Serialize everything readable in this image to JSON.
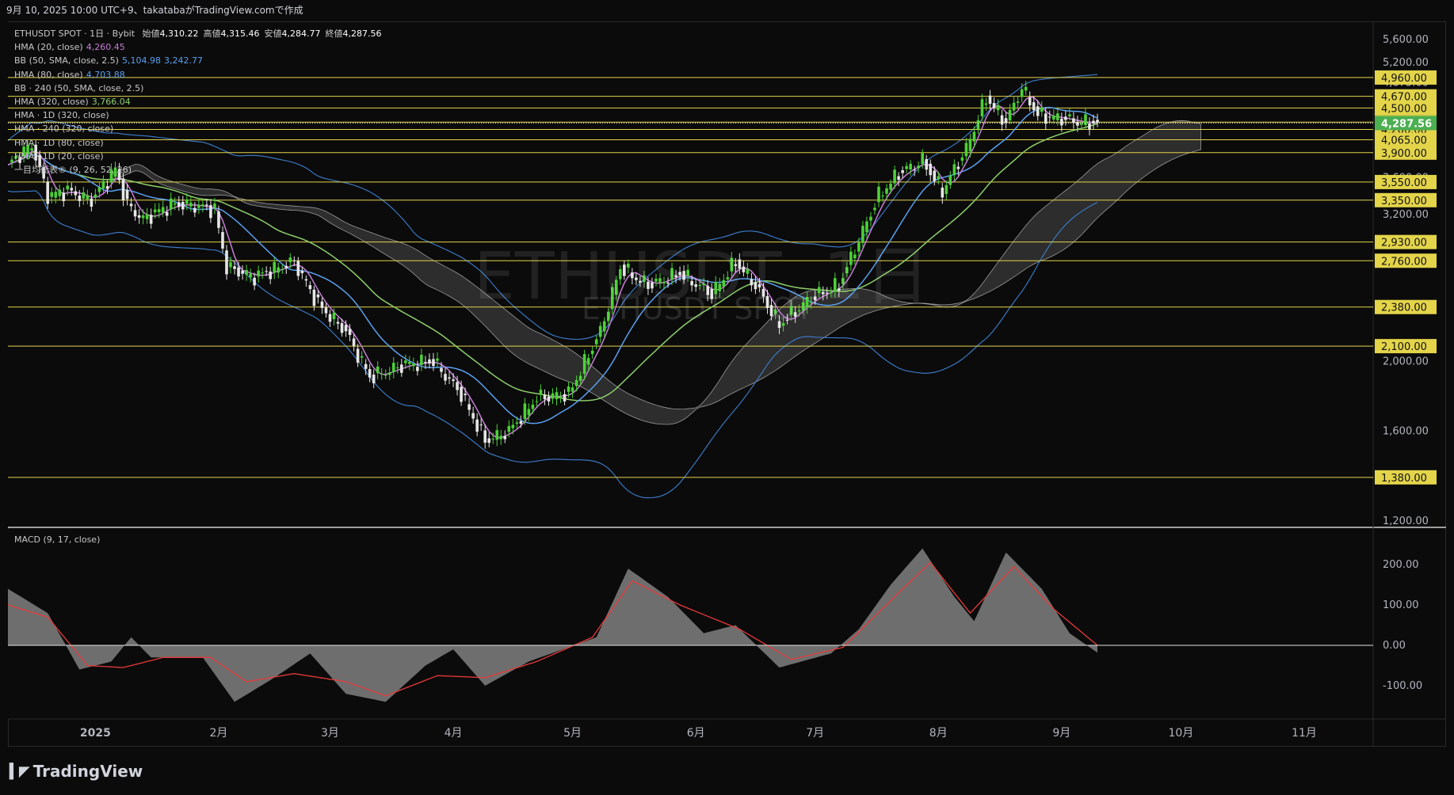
{
  "header": "9月 10, 2025 10:00 UTC+9、takatabaがTradingView.comで作成",
  "watermark": {
    "symbol": "ETHUSDT, 1日",
    "sub": "ETHUSDT SPOT"
  },
  "legend": {
    "title": "ETHUSDT SPOT · 1日 · Bybit",
    "ohlc": [
      {
        "label": "始値",
        "value": "4,310.22"
      },
      {
        "label": "高値",
        "value": "4,315.46"
      },
      {
        "label": "安値",
        "value": "4,284.77"
      },
      {
        "label": "終値",
        "value": "4,287.56"
      }
    ],
    "indicators": [
      {
        "label": "HMA (20, close)",
        "values": [
          "4,260.45"
        ],
        "color": "#c77dd6"
      },
      {
        "label": "BB (50, SMA, close, 2.5)",
        "values": [
          "5,104.98",
          "3,242.77"
        ],
        "color": "#5aa0f0"
      },
      {
        "label": "HMA (80, close)",
        "values": [
          "4,703.88"
        ],
        "color": "#5aa0f0"
      },
      {
        "label": "BB · 240 (50, SMA, close, 2.5)",
        "values": [],
        "color": "#c8c8c8"
      },
      {
        "label": "HMA (320, close)",
        "values": [
          "3,766.04"
        ],
        "color": "#8ed06a"
      },
      {
        "label": "HMA · 1D (320, close)",
        "values": [],
        "color": "#c8c8c8"
      },
      {
        "label": "HMA · 240 (320, close)",
        "values": [],
        "color": "#c8c8c8"
      },
      {
        "label": "HMA · 1D (80, close)",
        "values": [],
        "color": "#c8c8c8"
      },
      {
        "label": "HMA · 1D (20, close)",
        "values": [],
        "color": "#c8c8c8"
      },
      {
        "label": "一目均衡表® (9, 26, 52, 26)",
        "values": [],
        "color": "#c8c8c8"
      }
    ]
  },
  "macd_title": "MACD (9, 17, close)",
  "logo": "TradingView",
  "colors": {
    "background": "#0b0b0b",
    "up": "#4cd137",
    "down": "#e6e6e6",
    "hline": "#e3d44a",
    "hma20": "#c77dd6",
    "hma80": "#5aa0f0",
    "hma320": "#8ed06a",
    "bb": "#3d7fd0",
    "cloud": "#3a3a3a",
    "macd_hist": "#6e6e6e",
    "macd_signal": "#e83a3a",
    "price_tag": "#4caf50"
  },
  "chart_data": {
    "type": "candlestick",
    "price_axis": {
      "scale": "log",
      "ticks": [
        "5,600.00",
        "5,200.00",
        "4,875.00",
        "3,600.00",
        "3,200.00",
        "2,000.00",
        "1,600.00",
        "1,200.00"
      ]
    },
    "time_axis": {
      "labels": [
        "2025",
        "2月",
        "3月",
        "4月",
        "5月",
        "6月",
        "7月",
        "8月",
        "9月",
        "10月",
        "11月"
      ]
    },
    "horizontal_levels": [
      4960,
      4670,
      4500,
      4300,
      4200,
      4065,
      3900,
      3550,
      3350,
      2930,
      2760,
      2380,
      2100,
      1380
    ],
    "level_labels": [
      "4,960.00",
      "4,670.00",
      "4,500.00",
      "4,300.00",
      "4,200.00",
      "4,065.00",
      "3,900.00",
      "3,550.00",
      "3,350.00",
      "2,930.00",
      "2,760.00",
      "2,380.00",
      "2,100.00",
      "1,380.00"
    ],
    "current_price": 4287.56,
    "current_price_label": "4,287.56",
    "close_path": [
      [
        "2024-12-10",
        3750
      ],
      [
        "2024-12-16",
        4000
      ],
      [
        "2024-12-20",
        3400
      ],
      [
        "2024-12-25",
        3450
      ],
      [
        "2024-12-31",
        3350
      ],
      [
        "2025-01-06",
        3700
      ],
      [
        "2025-01-09",
        3300
      ],
      [
        "2025-01-13",
        3150
      ],
      [
        "2025-01-20",
        3300
      ],
      [
        "2025-01-25",
        3300
      ],
      [
        "2025-01-31",
        3250
      ],
      [
        "2025-02-03",
        2700
      ],
      [
        "2025-02-10",
        2620
      ],
      [
        "2025-02-20",
        2750
      ],
      [
        "2025-02-26",
        2400
      ],
      [
        "2025-03-05",
        2200
      ],
      [
        "2025-03-11",
        1900
      ],
      [
        "2025-03-20",
        1980
      ],
      [
        "2025-03-27",
        2000
      ],
      [
        "2025-04-03",
        1800
      ],
      [
        "2025-04-09",
        1550
      ],
      [
        "2025-04-15",
        1600
      ],
      [
        "2025-04-22",
        1780
      ],
      [
        "2025-04-30",
        1800
      ],
      [
        "2025-05-08",
        2200
      ],
      [
        "2025-05-13",
        2700
      ],
      [
        "2025-05-20",
        2550
      ],
      [
        "2025-05-28",
        2650
      ],
      [
        "2025-06-05",
        2480
      ],
      [
        "2025-06-11",
        2750
      ],
      [
        "2025-06-16",
        2550
      ],
      [
        "2025-06-22",
        2250
      ],
      [
        "2025-06-30",
        2450
      ],
      [
        "2025-07-07",
        2550
      ],
      [
        "2025-07-12",
        2950
      ],
      [
        "2025-07-17",
        3400
      ],
      [
        "2025-07-22",
        3650
      ],
      [
        "2025-07-28",
        3800
      ],
      [
        "2025-08-02",
        3450
      ],
      [
        "2025-08-08",
        3950
      ],
      [
        "2025-08-13",
        4650
      ],
      [
        "2025-08-18",
        4300
      ],
      [
        "2025-08-22",
        4800
      ],
      [
        "2025-08-26",
        4400
      ],
      [
        "2025-09-01",
        4350
      ],
      [
        "2025-09-05",
        4300
      ],
      [
        "2025-09-10",
        4287.56
      ]
    ],
    "macd": {
      "axis_ticks": [
        "200.00",
        "100.00",
        "0.00",
        "-100.00"
      ],
      "histogram_path": [
        [
          "2024-12-10",
          140
        ],
        [
          "2024-12-20",
          80
        ],
        [
          "2024-12-28",
          -60
        ],
        [
          "2025-01-05",
          -40
        ],
        [
          "2025-01-10",
          20
        ],
        [
          "2025-01-15",
          -30
        ],
        [
          "2025-01-28",
          -30
        ],
        [
          "2025-02-05",
          -140
        ],
        [
          "2025-02-15",
          -80
        ],
        [
          "2025-02-24",
          -20
        ],
        [
          "2025-03-05",
          -120
        ],
        [
          "2025-03-15",
          -140
        ],
        [
          "2025-03-25",
          -50
        ],
        [
          "2025-04-01",
          -10
        ],
        [
          "2025-04-09",
          -100
        ],
        [
          "2025-04-20",
          -40
        ],
        [
          "2025-04-30",
          -5
        ],
        [
          "2025-05-07",
          20
        ],
        [
          "2025-05-15",
          190
        ],
        [
          "2025-05-25",
          120
        ],
        [
          "2025-06-03",
          30
        ],
        [
          "2025-06-11",
          50
        ],
        [
          "2025-06-22",
          -55
        ],
        [
          "2025-07-05",
          -20
        ],
        [
          "2025-07-12",
          40
        ],
        [
          "2025-07-20",
          150
        ],
        [
          "2025-07-28",
          240
        ],
        [
          "2025-08-05",
          120
        ],
        [
          "2025-08-10",
          60
        ],
        [
          "2025-08-18",
          230
        ],
        [
          "2025-08-27",
          140
        ],
        [
          "2025-09-03",
          30
        ],
        [
          "2025-09-10",
          -18
        ]
      ],
      "signal_path": [
        [
          "2024-12-10",
          100
        ],
        [
          "2024-12-20",
          70
        ],
        [
          "2024-12-30",
          -50
        ],
        [
          "2025-01-08",
          -55
        ],
        [
          "2025-01-18",
          -30
        ],
        [
          "2025-01-30",
          -30
        ],
        [
          "2025-02-08",
          -90
        ],
        [
          "2025-02-20",
          -70
        ],
        [
          "2025-03-05",
          -90
        ],
        [
          "2025-03-15",
          -125
        ],
        [
          "2025-03-28",
          -75
        ],
        [
          "2025-04-09",
          -80
        ],
        [
          "2025-04-22",
          -40
        ],
        [
          "2025-05-06",
          20
        ],
        [
          "2025-05-16",
          160
        ],
        [
          "2025-05-28",
          100
        ],
        [
          "2025-06-12",
          40
        ],
        [
          "2025-06-25",
          -35
        ],
        [
          "2025-07-08",
          -5
        ],
        [
          "2025-07-22",
          130
        ],
        [
          "2025-07-30",
          205
        ],
        [
          "2025-08-09",
          80
        ],
        [
          "2025-08-20",
          195
        ],
        [
          "2025-08-30",
          90
        ],
        [
          "2025-09-10",
          0
        ]
      ]
    }
  }
}
